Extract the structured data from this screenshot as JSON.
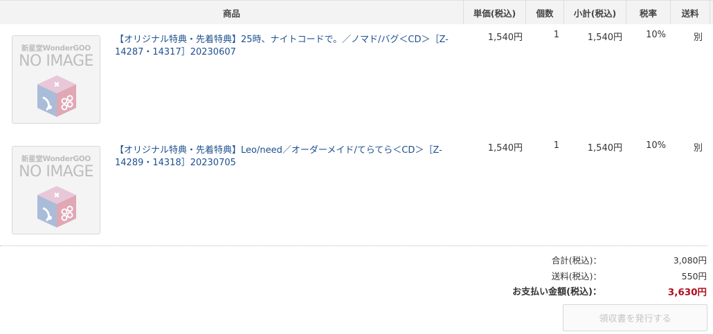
{
  "table": {
    "headers": {
      "product": "商品",
      "unit_price": "単価(税込)",
      "quantity": "個数",
      "subtotal": "小計(税込)",
      "tax_rate": "税率",
      "shipping": "送料"
    },
    "items": [
      {
        "thumbnail": {
          "brand": "新星堂WonderGOO",
          "text": "NO IMAGE",
          "icon": "no-image-cube-icon"
        },
        "title": "【オリジナル特典・先着特典】25時、ナイトコードで。／ノマド/バグ＜CD＞［Z-14287・14317］20230607",
        "unit_price": "1,540円",
        "quantity": "1",
        "subtotal": "1,540円",
        "tax_rate": "10%",
        "shipping": "別"
      },
      {
        "thumbnail": {
          "brand": "新星堂WonderGOO",
          "text": "NO IMAGE",
          "icon": "no-image-cube-icon"
        },
        "title": "【オリジナル特典・先着特典】Leo/need／オーダーメイド/てらてら＜CD＞［Z-14289・14318］20230705",
        "unit_price": "1,540円",
        "quantity": "1",
        "subtotal": "1,540円",
        "tax_rate": "10%",
        "shipping": "別"
      }
    ]
  },
  "summary": {
    "subtotal_label": "合計(税込)：",
    "subtotal_value": "3,080円",
    "shipping_label": "送料(税込)：",
    "shipping_value": "550円",
    "total_label": "お支払い金額(税込)：",
    "total_value": "3,630円"
  },
  "actions": {
    "receipt_button": "領収書を発行する"
  },
  "colors": {
    "link": "#1d4f8f",
    "total": "#b00e1d",
    "header_bg": "#f3f3f3",
    "disabled_text": "#c4c4c4"
  }
}
